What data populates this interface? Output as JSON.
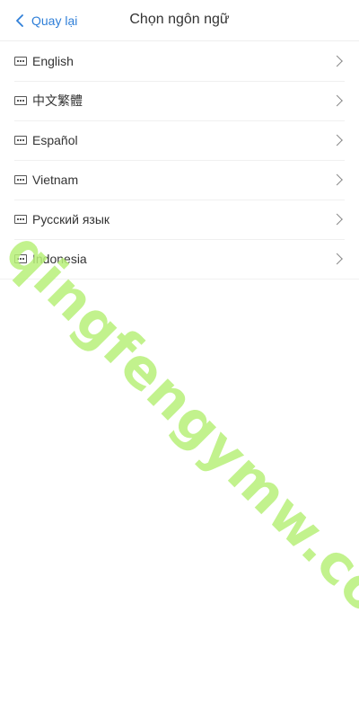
{
  "header": {
    "back_label": "Quay lại",
    "title": "Chọn ngôn ngữ",
    "accent_color": "#2f7fd8"
  },
  "languages": [
    {
      "label": "English",
      "icon": "keyboard-icon"
    },
    {
      "label": "中文繁體",
      "icon": "keyboard-icon"
    },
    {
      "label": "Español",
      "icon": "keyboard-icon"
    },
    {
      "label": "Vietnam",
      "icon": "keyboard-icon"
    },
    {
      "label": "Русский язык",
      "icon": "keyboard-icon"
    },
    {
      "label": "Indonesia",
      "icon": "keyboard-icon"
    }
  ],
  "watermark": {
    "text": "qingfengymw.com",
    "color": "#b8f07a"
  }
}
